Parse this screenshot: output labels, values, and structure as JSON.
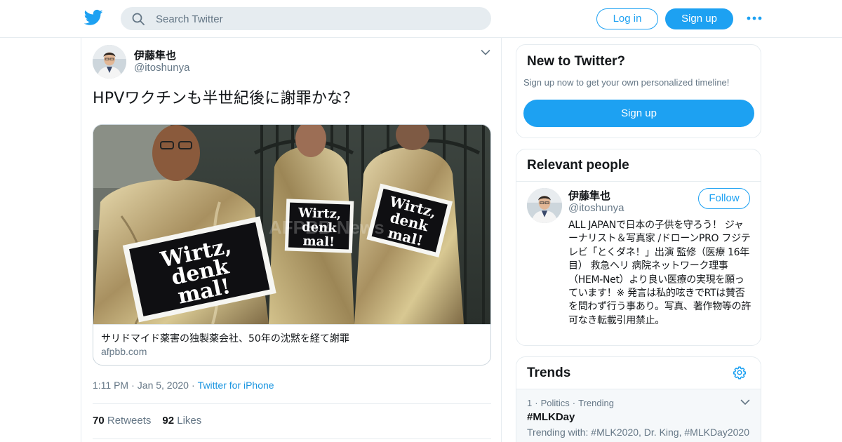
{
  "colors": {
    "brand": "#1da1f2",
    "link": "#1b95e0",
    "muted": "#657786",
    "border": "#e6ecf0"
  },
  "header": {
    "logo_icon": "twitter-bird-icon",
    "search": {
      "placeholder": "Search Twitter",
      "value": ""
    },
    "login_label": "Log in",
    "signup_label": "Sign up",
    "more_icon": "more-dots-icon"
  },
  "tweet": {
    "author": {
      "name": "伊藤隼也",
      "handle": "@itoshunya"
    },
    "text": "HPVワクチンも半世紀後に謝罪かな？",
    "card": {
      "image_signs": [
        "Wirtz,",
        "denk",
        "mal!"
      ],
      "watermark": "AFPBB News",
      "title": "サリドマイド薬害の独製薬会社、50年の沈黙を経て謝罪",
      "domain": "afpbb.com"
    },
    "meta": {
      "time": "1:11 PM",
      "date": "Jan 5, 2020",
      "source": "Twitter for iPhone"
    },
    "stats": {
      "retweets_count": "70",
      "retweets_label": "Retweets",
      "likes_count": "92",
      "likes_label": "Likes"
    }
  },
  "sidebar": {
    "new_to_twitter": {
      "title": "New to Twitter?",
      "subtitle": "Sign up now to get your own personalized timeline!",
      "button_label": "Sign up"
    },
    "relevant_people": {
      "title": "Relevant people",
      "person": {
        "name": "伊藤隼也",
        "handle": "@itoshunya",
        "follow_label": "Follow",
        "bio": "ALL JAPANで日本の子供を守ろう！ ジャーナリスト＆写真家 /ドローンPRO フジテレビ「とくダネ！」出演 監修（医療 16年目） 救急ヘリ 病院ネットワーク理事（HEM-Net）より良い医療の実現を願っています！※ 発言は私的呟きでRTは賛否を問わず行う事あり。写真、著作物等の許可なき転載引用禁止。"
      }
    },
    "trends": {
      "title": "Trends",
      "items": [
        {
          "rank": "1",
          "category": "Politics",
          "status": "Trending",
          "tag": "#MLKDay",
          "trending_with": "Trending with: #MLK2020, Dr. King, #MLKDay2020"
        }
      ]
    }
  }
}
